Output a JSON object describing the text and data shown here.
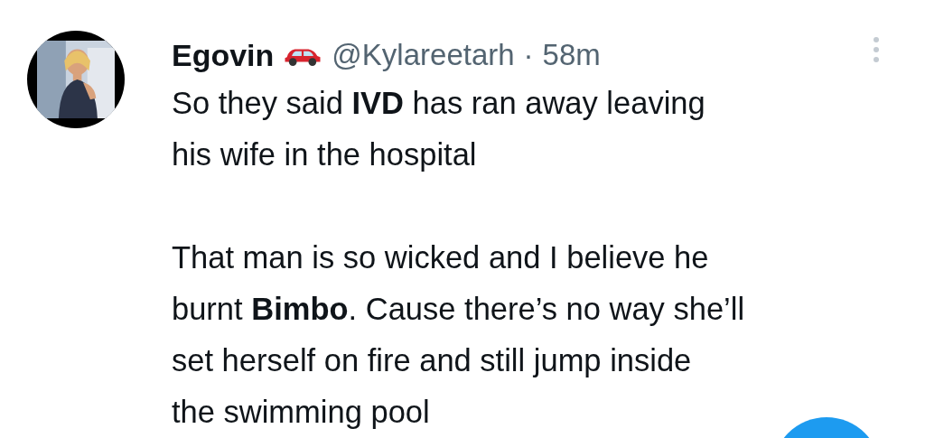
{
  "tweet": {
    "display_name": "Egovin",
    "handle": "@Kylareetarh",
    "separator": "·",
    "time": "58m",
    "paragraphs": [
      "So they said **IVD** has ran away leaving\nhis wife in the hospital",
      "That man is so wicked and I believe he\nburnt **Bimbo**. Cause there’s no way she’ll\nset herself on fire and still jump inside\nthe swimming pool"
    ]
  }
}
